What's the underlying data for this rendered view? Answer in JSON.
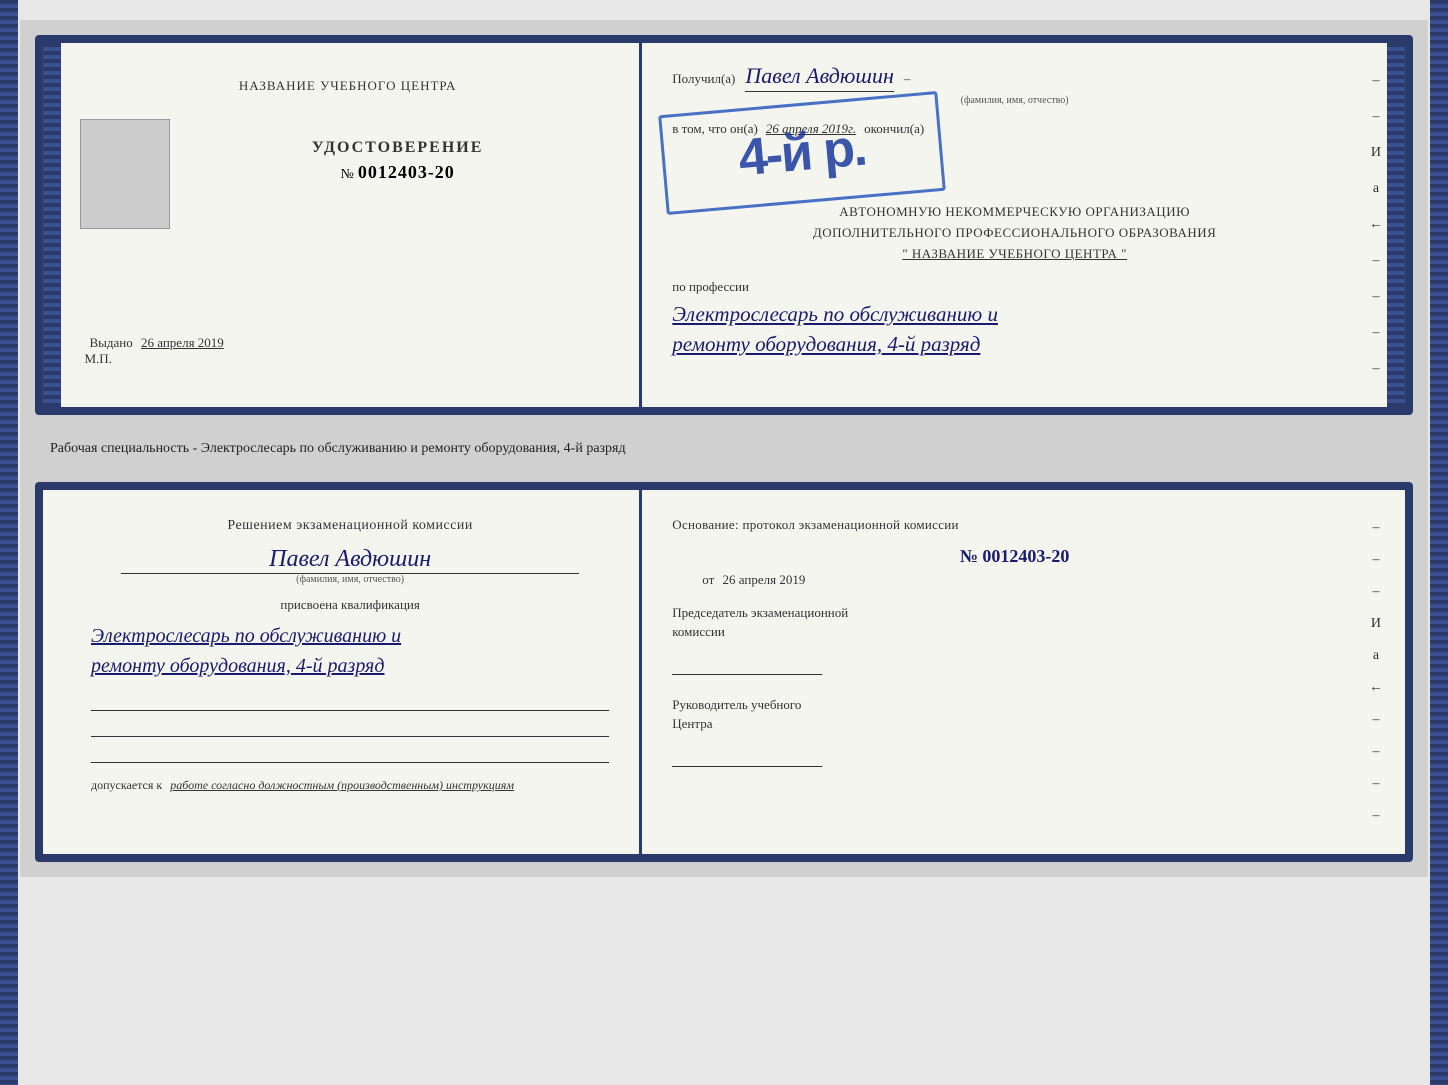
{
  "top_doc": {
    "left": {
      "title": "НАЗВАНИЕ УЧЕБНОГО ЦЕНТРА",
      "udostoverenie_label": "УДОСТОВЕРЕНИЕ",
      "number_prefix": "№",
      "number": "0012403-20",
      "vydano_label": "Выдано",
      "vydano_date": "26 апреля 2019",
      "mp_label": "М.П."
    },
    "right": {
      "poluchil_label": "Получил(a)",
      "person_name": "Павел Авдюшин",
      "fio_label": "(фамилия, имя, отчество)",
      "vtom_label": "в том, что он(a)",
      "vtom_date": "26 апреля 2019г.",
      "okonchil_label": "окончил(а)",
      "stamp_number": "4-й р.",
      "org_line1": "АВТОНОМНУЮ НЕКОММЕРЧЕСКУЮ ОРГАНИЗАЦИЮ",
      "org_line2": "ДОПОЛНИТЕЛЬНОГО ПРОФЕССИОНАЛЬНОГО ОБРАЗОВАНИЯ",
      "org_line3": "\" НАЗВАНИЕ УЧЕБНОГО ЦЕНТРА \"",
      "profession_label": "по профессии",
      "profession_text_line1": "Электрослесарь по обслуживанию и",
      "profession_text_line2": "ремонту оборудования, 4-й разряд",
      "right_dashes": [
        "-",
        "-",
        "-",
        "И",
        "а",
        "←",
        "-",
        "-",
        "-",
        "-"
      ]
    }
  },
  "middle_text": "Рабочая специальность - Электрослесарь по обслуживанию и ремонту оборудования, 4-й разряд",
  "bottom_doc": {
    "left": {
      "komissia_line1": "Решением экзаменационной комиссии",
      "person_name": "Павел Авдюшин",
      "fio_label": "(фамилия, имя, отчество)",
      "prisvoena_label": "присвоена квалификация",
      "qualification_line1": "Электрослесарь по обслуживанию и",
      "qualification_line2": "ремонту оборудования, 4-й разряд",
      "dopuskaetsya_label": "допускается к",
      "dopuskaetsya_text": "работе согласно должностным (производственным) инструкциям"
    },
    "right": {
      "osnovaniye_label": "Основание: протокол экзаменационной комиссии",
      "protocol_prefix": "№",
      "protocol_number": "0012403-20",
      "ot_label": "от",
      "ot_date": "26 апреля 2019",
      "chairman_title_line1": "Председатель экзаменационной",
      "chairman_title_line2": "комиссии",
      "rukovoditel_line1": "Руководитель учебного",
      "rukovoditel_line2": "Центра",
      "right_dashes": [
        "-",
        "-",
        "-",
        "И",
        "а",
        "←",
        "-",
        "-",
        "-",
        "-"
      ]
    }
  }
}
